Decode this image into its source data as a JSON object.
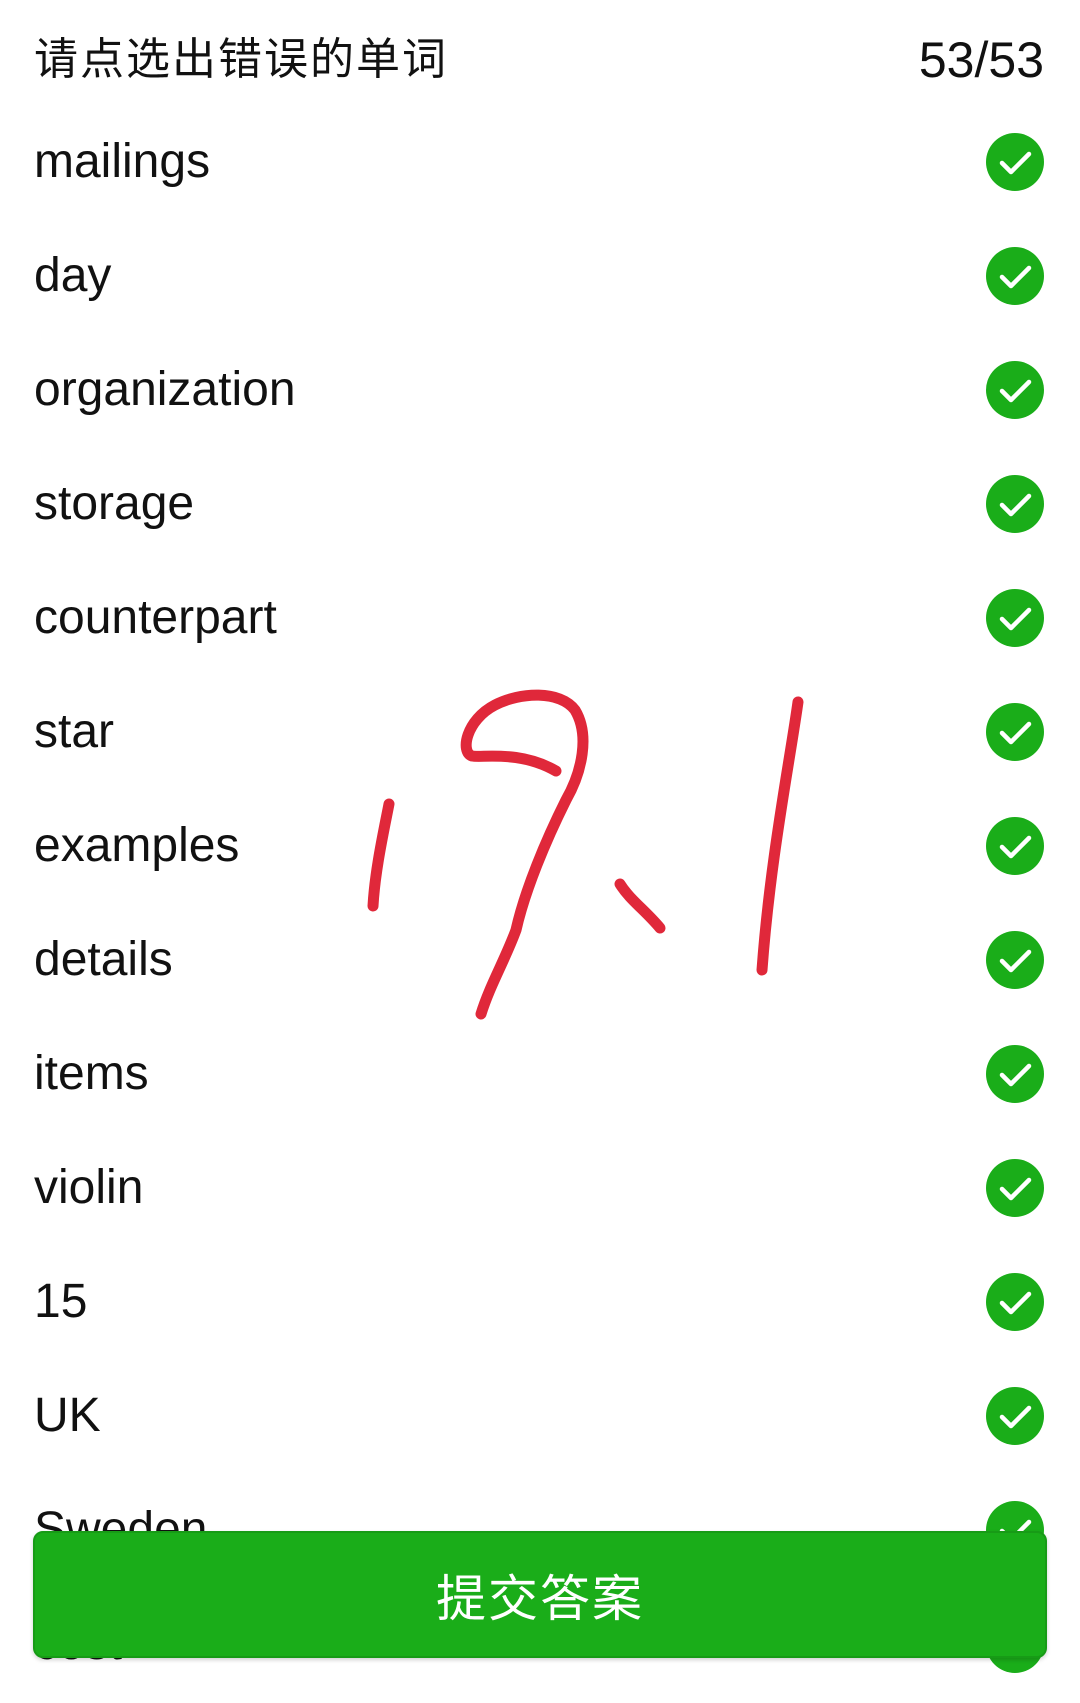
{
  "header": {
    "title": "请点选出错误的单词",
    "progress": "53/53"
  },
  "words": [
    {
      "text": "mailings",
      "status": "correct"
    },
    {
      "text": "day",
      "status": "correct"
    },
    {
      "text": "organization",
      "status": "correct"
    },
    {
      "text": "storage",
      "status": "correct"
    },
    {
      "text": "counterpart",
      "status": "correct"
    },
    {
      "text": "star",
      "status": "correct"
    },
    {
      "text": "examples",
      "status": "correct"
    },
    {
      "text": "details",
      "status": "correct"
    },
    {
      "text": "items",
      "status": "correct"
    },
    {
      "text": "violin",
      "status": "correct"
    },
    {
      "text": "15",
      "status": "correct"
    },
    {
      "text": "UK",
      "status": "correct"
    },
    {
      "text": "Sweden",
      "status": "correct"
    },
    {
      "text": "cost",
      "status": "correct"
    }
  ],
  "submit_button": {
    "label": "提交答案"
  },
  "annotation": {
    "handwritten_text": "19.1"
  },
  "colors": {
    "check_green": "#1aad19",
    "submit_green": "#1aad19",
    "ink_red": "#e0283a"
  },
  "icons": {
    "status": "check-circle-icon"
  }
}
